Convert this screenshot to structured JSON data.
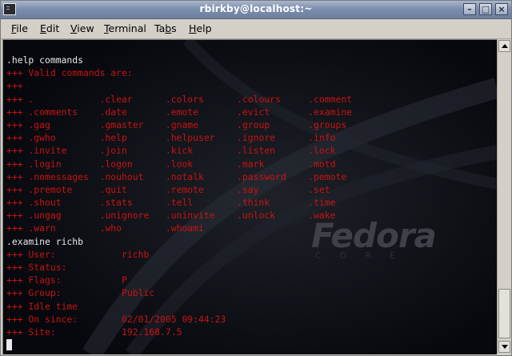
{
  "window": {
    "title": "rbirkby@localhost:~"
  },
  "menu": [
    {
      "accel": "F",
      "rest": "ile"
    },
    {
      "accel": "E",
      "rest": "dit"
    },
    {
      "accel": "V",
      "rest": "iew"
    },
    {
      "accel": "T",
      "rest": "erminal"
    },
    {
      "pre": "Ta",
      "accel": "b",
      "rest": "s"
    },
    {
      "accel": "H",
      "rest": "elp"
    }
  ],
  "terminal": {
    "lines": [
      {
        "text": ".help commands",
        "color": "white"
      },
      {
        "text": "+++ Valid commands are:",
        "color": "red"
      },
      {
        "text": "+++",
        "color": "red"
      },
      {
        "text": "+++ .            .clear      .colors      .colours     .comment",
        "color": "red"
      },
      {
        "text": "+++ .comments    .date       .emote       .evict       .examine",
        "color": "red"
      },
      {
        "text": "+++ .gag         .gmaster    .gname       .group       .groups",
        "color": "red"
      },
      {
        "text": "+++ .gwho        .help       .helpuser    .ignore      .info",
        "color": "red"
      },
      {
        "text": "+++ .invite      .join       .kick        .listen      .lock",
        "color": "red"
      },
      {
        "text": "+++ .login       .logon      .look        .mark        .motd",
        "color": "red"
      },
      {
        "text": "+++ .nomessages  .nouhout    .notalk      .password    .pemote",
        "color": "red"
      },
      {
        "text": "+++ .premote     .quit       .remote      .say         .set",
        "color": "red"
      },
      {
        "text": "+++ .shout       .stats      .tell        .think       .time",
        "color": "red"
      },
      {
        "text": "+++ .ungag       .unignore   .uninvite    .unlock      .wake",
        "color": "red"
      },
      {
        "text": "+++ .warn        .who        .whoami",
        "color": "red"
      },
      {
        "text": ".examine richb",
        "color": "white"
      },
      {
        "text": "+++ User:            richb",
        "color": "red"
      },
      {
        "text": "+++ Status:",
        "color": "red"
      },
      {
        "text": "+++ Flags:           P",
        "color": "red"
      },
      {
        "text": "+++ Group:           Public",
        "color": "red"
      },
      {
        "text": "+++ Idle time",
        "color": "red"
      },
      {
        "text": "+++ On since:        02/01/2005 09:44:23",
        "color": "red"
      },
      {
        "text": "+++ Site:            192.168.7.5",
        "color": "red"
      }
    ],
    "prompt": ""
  },
  "logo": {
    "word": "Fedora",
    "sub": "CORE"
  },
  "colors": {
    "text_white": "#e9e9e9",
    "text_red": "#c81313",
    "background": "#06080d"
  },
  "icons": {
    "app": "terminal-icon",
    "minimize": "minimize-icon",
    "maximize": "maximize-icon",
    "close": "close-icon"
  }
}
